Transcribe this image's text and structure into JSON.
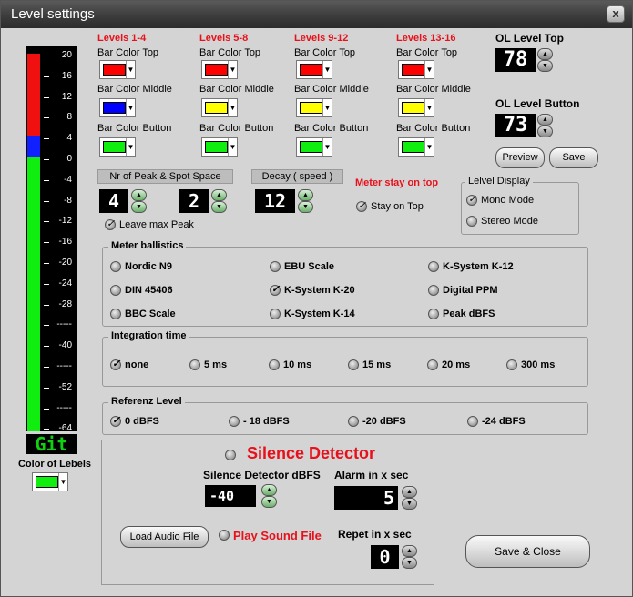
{
  "window": {
    "title": "Level settings",
    "close": "x"
  },
  "meter": {
    "ticks": [
      "20",
      "16",
      "12",
      "8",
      "4",
      "0",
      "-4",
      "-8",
      "-12",
      "-16",
      "-20",
      "-24",
      "-28",
      "-----",
      "-40",
      "-----",
      "-52",
      "-----",
      "-64"
    ],
    "label_display": "Git",
    "color_label": "Color of Lebels",
    "colors": {
      "red": "#f01010",
      "blue": "#1020ff",
      "green": "#10ee10"
    }
  },
  "levels": [
    {
      "title": "Levels 1-4",
      "top": "Bar Color Top",
      "mid": "Bar Color Middle",
      "btm": "Bar Color Button",
      "c": [
        "#ff0000",
        "#0000ff",
        "#10ee10"
      ]
    },
    {
      "title": "Levels 5-8",
      "top": "Bar Color Top",
      "mid": "Bar Color Middle",
      "btm": "Bar Color Button",
      "c": [
        "#ff0000",
        "#ffff00",
        "#10ee10"
      ]
    },
    {
      "title": "Levels 9-12",
      "top": "Bar Color Top",
      "mid": "Bar Color Middle",
      "btm": "Bar Color Button",
      "c": [
        "#ff0000",
        "#ffff00",
        "#10ee10"
      ]
    },
    {
      "title": "Levels 13-16",
      "top": "Bar Color Top",
      "mid": "Bar Color Middle",
      "btm": "Bar Color Button",
      "c": [
        "#ff0000",
        "#ffff00",
        "#10ee10"
      ]
    }
  ],
  "ol": {
    "top_label": "OL Level Top",
    "top_value": "78",
    "btn_label": "OL Level Button",
    "btn_value": "73",
    "preview": "Preview",
    "save": "Save"
  },
  "peak": {
    "header": "Nr of Peak  & Spot Space",
    "nr": "4",
    "space": "2",
    "leave": "Leave max Peak"
  },
  "decay": {
    "header": "Decay ( speed )",
    "value": "12"
  },
  "stay": {
    "title": "Meter stay on top",
    "label": "Stay on Top"
  },
  "display": {
    "title": "Lelvel Display",
    "mono": "Mono  Mode",
    "stereo": "Stereo Mode"
  },
  "ballistics": {
    "title": "Meter ballistics",
    "items": [
      "Nordic N9",
      "EBU Scale",
      "K-System K-12",
      "DIN 45406",
      "K-System K-20",
      "Digital PPM",
      "BBC Scale",
      "K-System K-14",
      "Peak dBFS"
    ]
  },
  "integration": {
    "title": "Integration time",
    "items": [
      "none",
      "5 ms",
      "10 ms",
      "15 ms",
      "20 ms",
      "300 ms"
    ]
  },
  "referenz": {
    "title": "Referenz Level",
    "items": [
      "0 dBFS",
      "- 18 dBFS",
      "-20 dBFS",
      "-24 dBFS"
    ]
  },
  "silence": {
    "title": "Silence Detector",
    "dbfs_label": "Silence Detector dBFS",
    "dbfs_value": "-40",
    "alarm_label": "Alarm in x sec",
    "alarm_value": "5",
    "load": "Load Audio File",
    "play": "Play Sound File",
    "repeat_label": "Repet in x sec",
    "repeat_value": "0"
  },
  "save_close": "Save & Close"
}
